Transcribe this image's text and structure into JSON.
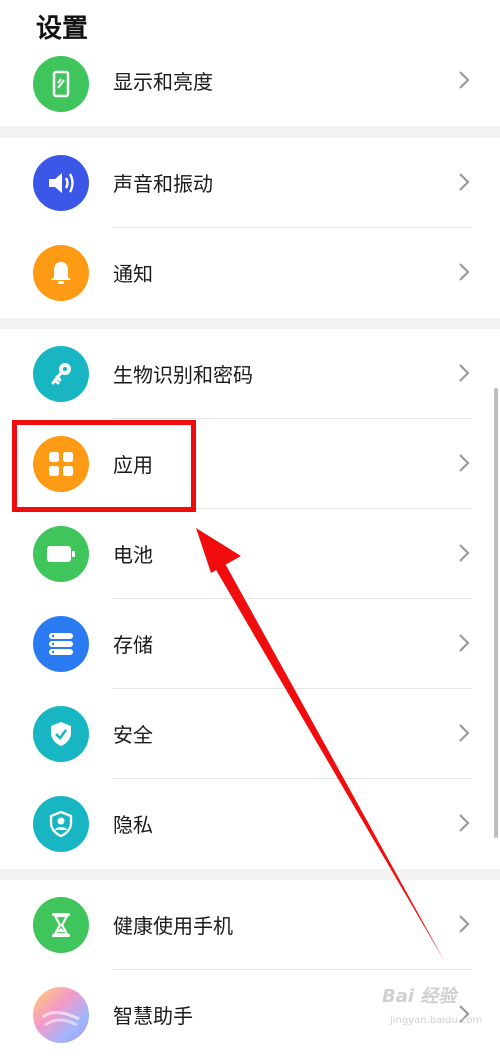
{
  "header": {
    "title": "设置"
  },
  "groups": [
    {
      "items": [
        {
          "label": "显示和亮度",
          "icon": "display-icon",
          "color": "#3fc55b"
        }
      ]
    },
    {
      "items": [
        {
          "label": "声音和振动",
          "icon": "volume-icon",
          "color": "#3a57e8"
        },
        {
          "label": "通知",
          "icon": "bell-icon",
          "color": "#ff9a14"
        }
      ]
    },
    {
      "items": [
        {
          "label": "生物识别和密码",
          "icon": "key-icon",
          "color": "#17b6c2"
        },
        {
          "label": "应用",
          "icon": "apps-grid-icon",
          "color": "#ff9a14"
        },
        {
          "label": "电池",
          "icon": "battery-icon",
          "color": "#3fc55b"
        },
        {
          "label": "存储",
          "icon": "storage-icon",
          "color": "#2a7bf2"
        },
        {
          "label": "安全",
          "icon": "shield-check-icon",
          "color": "#17b6c2"
        },
        {
          "label": "隐私",
          "icon": "privacy-shield-icon",
          "color": "#17b6c2"
        }
      ]
    },
    {
      "items": [
        {
          "label": "健康使用手机",
          "icon": "hourglass-icon",
          "color": "#3fc55b"
        },
        {
          "label": "智慧助手",
          "icon": "smart-assistant-icon",
          "color": "#b98ce8"
        }
      ]
    }
  ],
  "annotation": {
    "highlight_color": "#f10d0d",
    "target": "应用"
  },
  "watermark": {
    "text": "Bai 经验",
    "sub": "jingyan.baidu.com"
  }
}
